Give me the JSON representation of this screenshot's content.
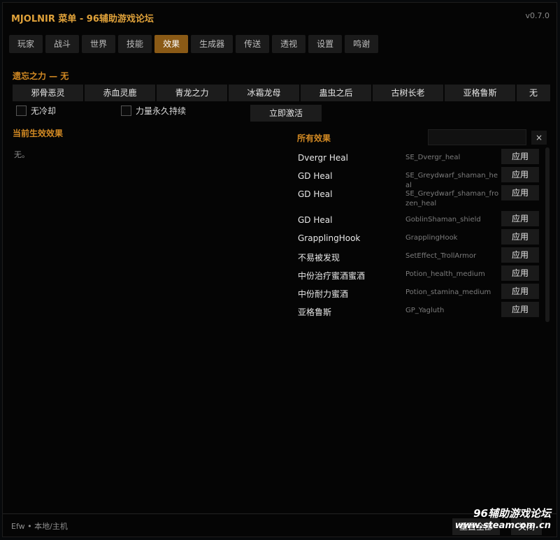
{
  "header": {
    "title": "MJOLNIR 菜单 - 96辅助游戏论坛",
    "version": "v0.7.0"
  },
  "tabs": [
    "玩家",
    "战斗",
    "世界",
    "技能",
    "效果",
    "生成器",
    "传送",
    "透视",
    "设置",
    "鸣谢"
  ],
  "active_tab": "效果",
  "forsaken": {
    "label": "遗忘之力  —  无",
    "buffs": [
      "邪骨恶灵",
      "赤血灵鹿",
      "青龙之力",
      "冰霜龙母",
      "蛊虫之后",
      "古树长老",
      "亚格鲁斯",
      "无"
    ]
  },
  "options": {
    "no_cooldown": "无冷却",
    "permanent": "力量永久持续",
    "activate": "立即激活"
  },
  "active_effects": {
    "label": "当前生效效果",
    "none": "无。"
  },
  "all_effects": {
    "label": "所有效果",
    "search_value": "",
    "clear": "×",
    "apply_label": "应用",
    "items": [
      {
        "name": "Dvergr Heal",
        "id": "SE_Dvergr_heal"
      },
      {
        "name": "GD Heal",
        "id": "SE_Greydwarf_shaman_heal"
      },
      {
        "name": "GD Heal",
        "id": "SE_Greydwarf_shaman_frozen_heal"
      },
      {
        "name": "GD Heal",
        "id": "GoblinShaman_shield"
      },
      {
        "name": "GrapplingHook",
        "id": "GrapplingHook"
      },
      {
        "name": "不易被发现",
        "id": "SetEffect_TrollArmor"
      },
      {
        "name": "中份治疗蜜酒蜜酒",
        "id": "Potion_health_medium"
      },
      {
        "name": "中份耐力蜜酒",
        "id": "Potion_stamina_medium"
      },
      {
        "name": "亚格鲁斯",
        "id": "GP_Yagluth"
      }
    ]
  },
  "footer": {
    "status": "Efw  •  本地/主机",
    "reset": "重置全部",
    "close": "关闭"
  },
  "watermark": {
    "line1": "96辅助游戏论坛",
    "line2": "www.steamcom.cn"
  }
}
